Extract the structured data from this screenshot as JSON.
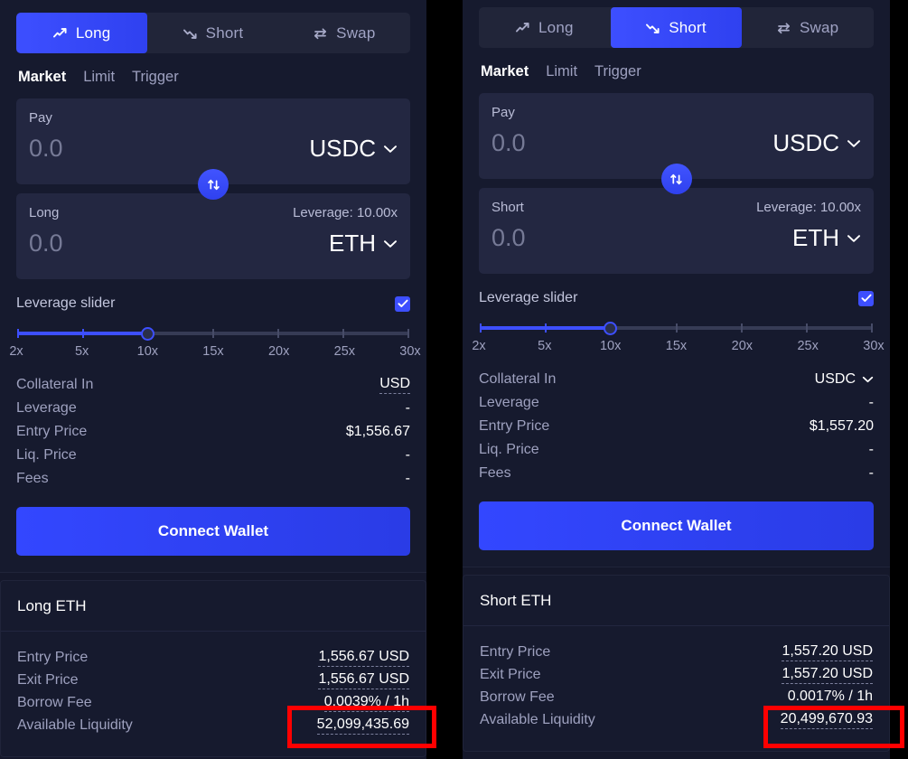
{
  "panels": [
    {
      "direction_tabs": [
        {
          "label": "Long",
          "icon": "trend-up-icon",
          "active": true
        },
        {
          "label": "Short",
          "icon": "trend-down-icon",
          "active": false
        },
        {
          "label": "Swap",
          "icon": "swap-arrows-icon",
          "active": false
        }
      ],
      "order_tabs": [
        {
          "label": "Market",
          "active": true
        },
        {
          "label": "Limit",
          "active": false
        },
        {
          "label": "Trigger",
          "active": false
        }
      ],
      "pay": {
        "label": "Pay",
        "value": "",
        "placeholder": "0.0",
        "token": "USDC"
      },
      "receive": {
        "label": "Long",
        "value": "",
        "placeholder": "0.0",
        "token": "ETH",
        "leverage_label": "Leverage: 10.00x"
      },
      "leverage": {
        "label": "Leverage slider",
        "enabled": true,
        "value": 10,
        "min": 2,
        "max": 30,
        "ticks": [
          "2x",
          "5x",
          "10x",
          "15x",
          "20x",
          "25x",
          "30x"
        ]
      },
      "stats": [
        {
          "label": "Collateral In",
          "value": "USD",
          "type": "dotted"
        },
        {
          "label": "Leverage",
          "value": "-",
          "type": "plain"
        },
        {
          "label": "Entry Price",
          "value": "$1,556.67",
          "type": "plain"
        },
        {
          "label": "Liq. Price",
          "value": "-",
          "type": "plain"
        },
        {
          "label": "Fees",
          "value": "-",
          "type": "plain"
        }
      ],
      "cta": "Connect Wallet",
      "info_card": {
        "title": "Long ETH",
        "rows": [
          {
            "label": "Entry Price",
            "value": "1,556.67 USD"
          },
          {
            "label": "Exit Price",
            "value": "1,556.67 USD"
          },
          {
            "label": "Borrow Fee",
            "value": "0.0039% / 1h"
          },
          {
            "label": "Available Liquidity",
            "value": "52,099,435.69"
          }
        ]
      }
    },
    {
      "direction_tabs": [
        {
          "label": "Long",
          "icon": "trend-up-icon",
          "active": false
        },
        {
          "label": "Short",
          "icon": "trend-down-icon",
          "active": true
        },
        {
          "label": "Swap",
          "icon": "swap-arrows-icon",
          "active": false
        }
      ],
      "order_tabs": [
        {
          "label": "Market",
          "active": true
        },
        {
          "label": "Limit",
          "active": false
        },
        {
          "label": "Trigger",
          "active": false
        }
      ],
      "pay": {
        "label": "Pay",
        "value": "",
        "placeholder": "0.0",
        "token": "USDC"
      },
      "receive": {
        "label": "Short",
        "value": "",
        "placeholder": "0.0",
        "token": "ETH",
        "leverage_label": "Leverage: 10.00x"
      },
      "leverage": {
        "label": "Leverage slider",
        "enabled": true,
        "value": 10,
        "min": 2,
        "max": 30,
        "ticks": [
          "2x",
          "5x",
          "10x",
          "15x",
          "20x",
          "25x",
          "30x"
        ]
      },
      "stats": [
        {
          "label": "Collateral In",
          "value": "USDC",
          "type": "select"
        },
        {
          "label": "Leverage",
          "value": "-",
          "type": "plain"
        },
        {
          "label": "Entry Price",
          "value": "$1,557.20",
          "type": "plain"
        },
        {
          "label": "Liq. Price",
          "value": "-",
          "type": "plain"
        },
        {
          "label": "Fees",
          "value": "-",
          "type": "plain"
        }
      ],
      "cta": "Connect Wallet",
      "info_card": {
        "title": "Short ETH",
        "rows": [
          {
            "label": "Entry Price",
            "value": "1,557.20 USD"
          },
          {
            "label": "Exit Price",
            "value": "1,557.20 USD"
          },
          {
            "label": "Borrow Fee",
            "value": "0.0017% / 1h"
          },
          {
            "label": "Available Liquidity",
            "value": "20,499,670.93"
          }
        ]
      }
    }
  ],
  "colors": {
    "accent": "#3d4fff",
    "panel_bg": "#161a2e",
    "field_bg": "#232741",
    "highlight": "#ff0000",
    "text": "#ffffff",
    "muted": "#9ea1bf"
  },
  "annotations": [
    {
      "name": "available-liquidity-left",
      "target": "panel0-available-liquidity"
    },
    {
      "name": "available-liquidity-right",
      "target": "panel1-available-liquidity"
    }
  ]
}
